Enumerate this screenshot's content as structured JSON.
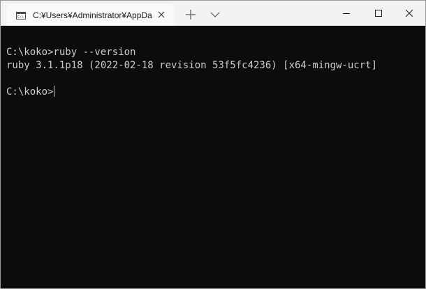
{
  "tab": {
    "title": "C:¥Users¥Administrator¥AppDa",
    "icon": "terminal-icon"
  },
  "toolbar": {
    "new_tab_icon": "plus-icon",
    "dropdown_icon": "chevron-down-icon"
  },
  "window_controls": {
    "minimize_icon": "minimize-icon",
    "maximize_icon": "maximize-icon",
    "close_icon": "close-icon"
  },
  "terminal": {
    "lines": [
      "C:\\koko>ruby --version",
      "ruby 3.1.1p18 (2022-02-18 revision 53f5fc4236) [x64-mingw-ucrt]",
      "",
      "C:\\koko>"
    ]
  },
  "colors": {
    "titlebar": "#f3f3f3",
    "tab": "#fafafa",
    "terminal_background": "#0c0c0c",
    "terminal_text": "#cccccc"
  }
}
